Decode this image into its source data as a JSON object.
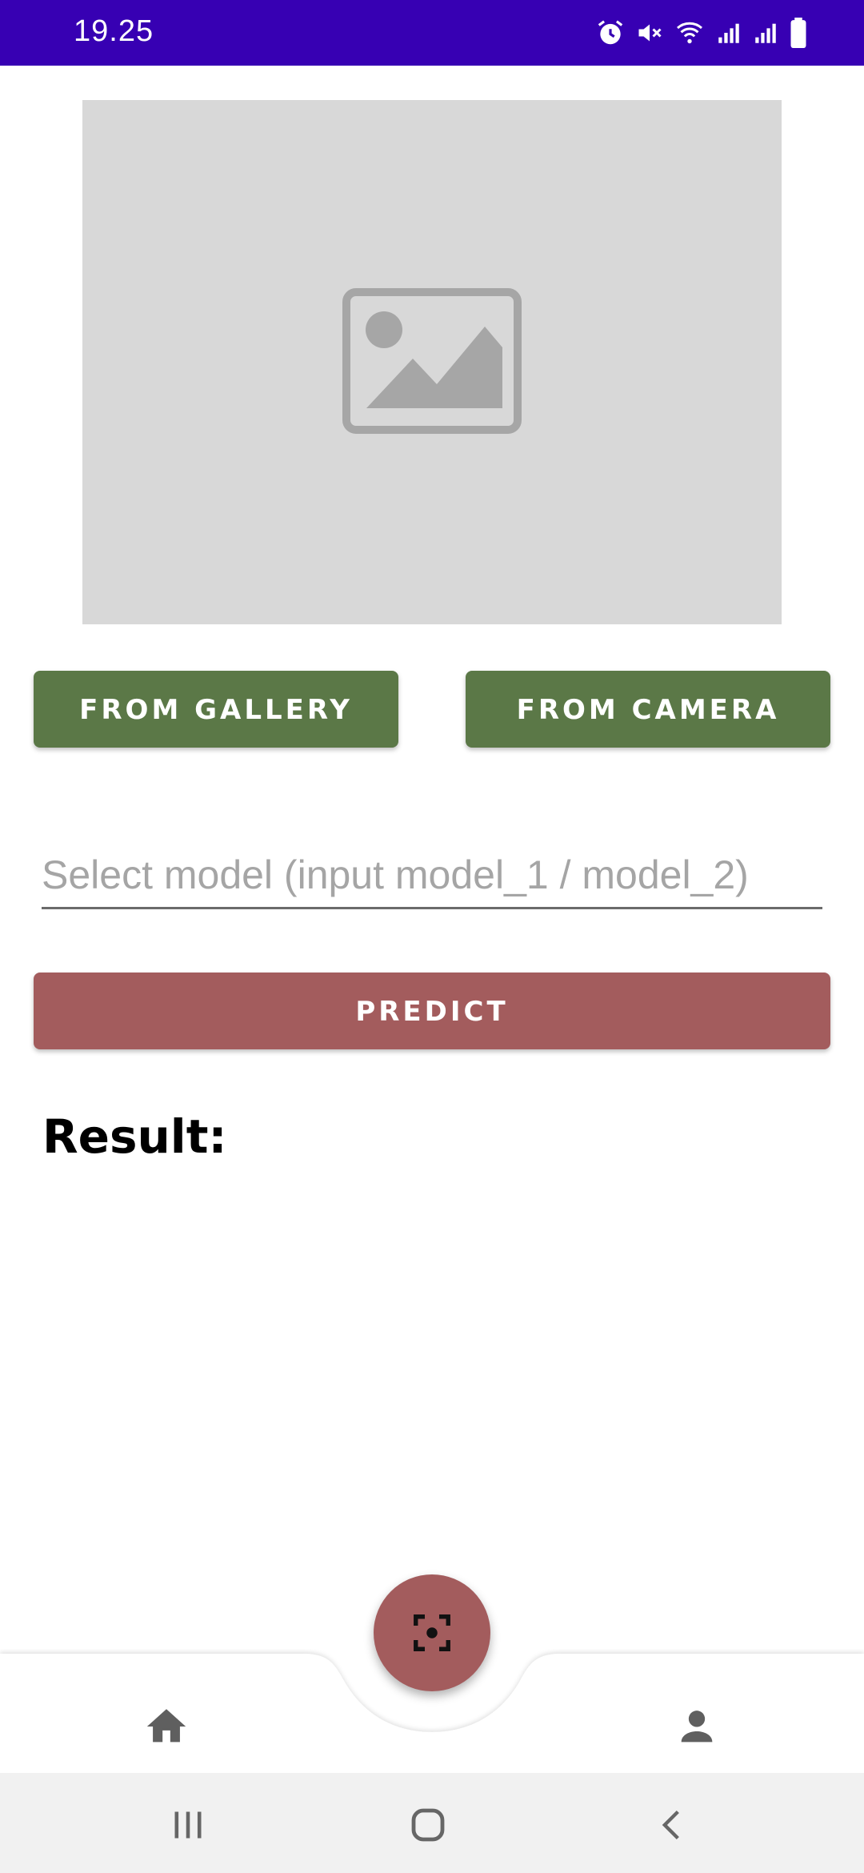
{
  "status_bar": {
    "time": "19.25",
    "icons": [
      "alarm-icon",
      "mute-icon",
      "wifi-icon",
      "signal-icon",
      "signal-icon",
      "battery-icon"
    ],
    "background": "#3700b3"
  },
  "image_preview": {
    "placeholder_icon": "image-placeholder-icon"
  },
  "buttons": {
    "gallery_label": "FROM GALLERY",
    "camera_label": "FROM CAMERA",
    "predict_label": "PREDICT"
  },
  "model_input": {
    "value": "",
    "placeholder": "Select model (input model_1 / model_2)"
  },
  "result": {
    "label": "Result:"
  },
  "bottom_nav": {
    "items": [
      {
        "icon": "home-icon"
      },
      {
        "icon": "profile-icon"
      }
    ],
    "fab_icon": "scan-icon"
  },
  "system_nav": {
    "items": [
      {
        "icon": "recents-icon"
      },
      {
        "icon": "home-circle-icon"
      },
      {
        "icon": "back-icon"
      }
    ]
  },
  "colors": {
    "accent_green": "#5b7847",
    "accent_red": "#a35c5d",
    "placeholder_gray": "#d8d8d8"
  }
}
